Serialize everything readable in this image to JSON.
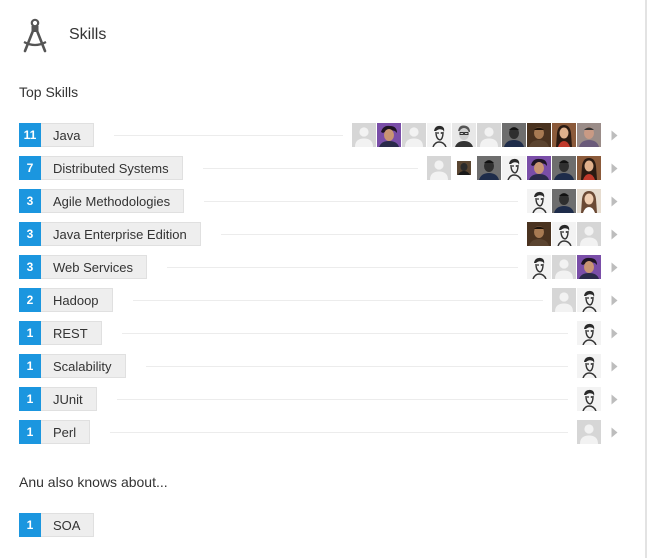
{
  "section": {
    "title": "Skills",
    "top_skills_heading": "Top Skills",
    "also_knows_heading": "Anu also knows about..."
  },
  "colors": {
    "count_badge": "#1b96df",
    "pill_background": "#eeeeee"
  },
  "top_skills": [
    {
      "name": "Java",
      "count": "11",
      "endorsers": [
        "placeholder",
        "purple",
        "placeholder",
        "sketch",
        "glasses",
        "placeholder",
        "dark",
        "brown",
        "woman",
        "man-gray"
      ]
    },
    {
      "name": "Distributed Systems",
      "count": "7",
      "endorsers": [
        "placeholder",
        "small-dark",
        "dark",
        "sketch",
        "purple",
        "dark",
        "woman"
      ]
    },
    {
      "name": "Agile Methodologies",
      "count": "3",
      "endorsers": [
        "sketch",
        "dark",
        "woman-light"
      ]
    },
    {
      "name": "Java Enterprise Edition",
      "count": "3",
      "endorsers": [
        "brown",
        "sketch",
        "placeholder"
      ]
    },
    {
      "name": "Web Services",
      "count": "3",
      "endorsers": [
        "sketch",
        "placeholder",
        "purple"
      ]
    },
    {
      "name": "Hadoop",
      "count": "2",
      "endorsers": [
        "placeholder",
        "sketch"
      ]
    },
    {
      "name": "REST",
      "count": "1",
      "endorsers": [
        "sketch"
      ]
    },
    {
      "name": "Scalability",
      "count": "1",
      "endorsers": [
        "sketch"
      ]
    },
    {
      "name": "JUnit",
      "count": "1",
      "endorsers": [
        "sketch"
      ]
    },
    {
      "name": "Perl",
      "count": "1",
      "endorsers": [
        "placeholder"
      ]
    }
  ],
  "also_knows": [
    {
      "name": "SOA",
      "count": "1"
    }
  ]
}
